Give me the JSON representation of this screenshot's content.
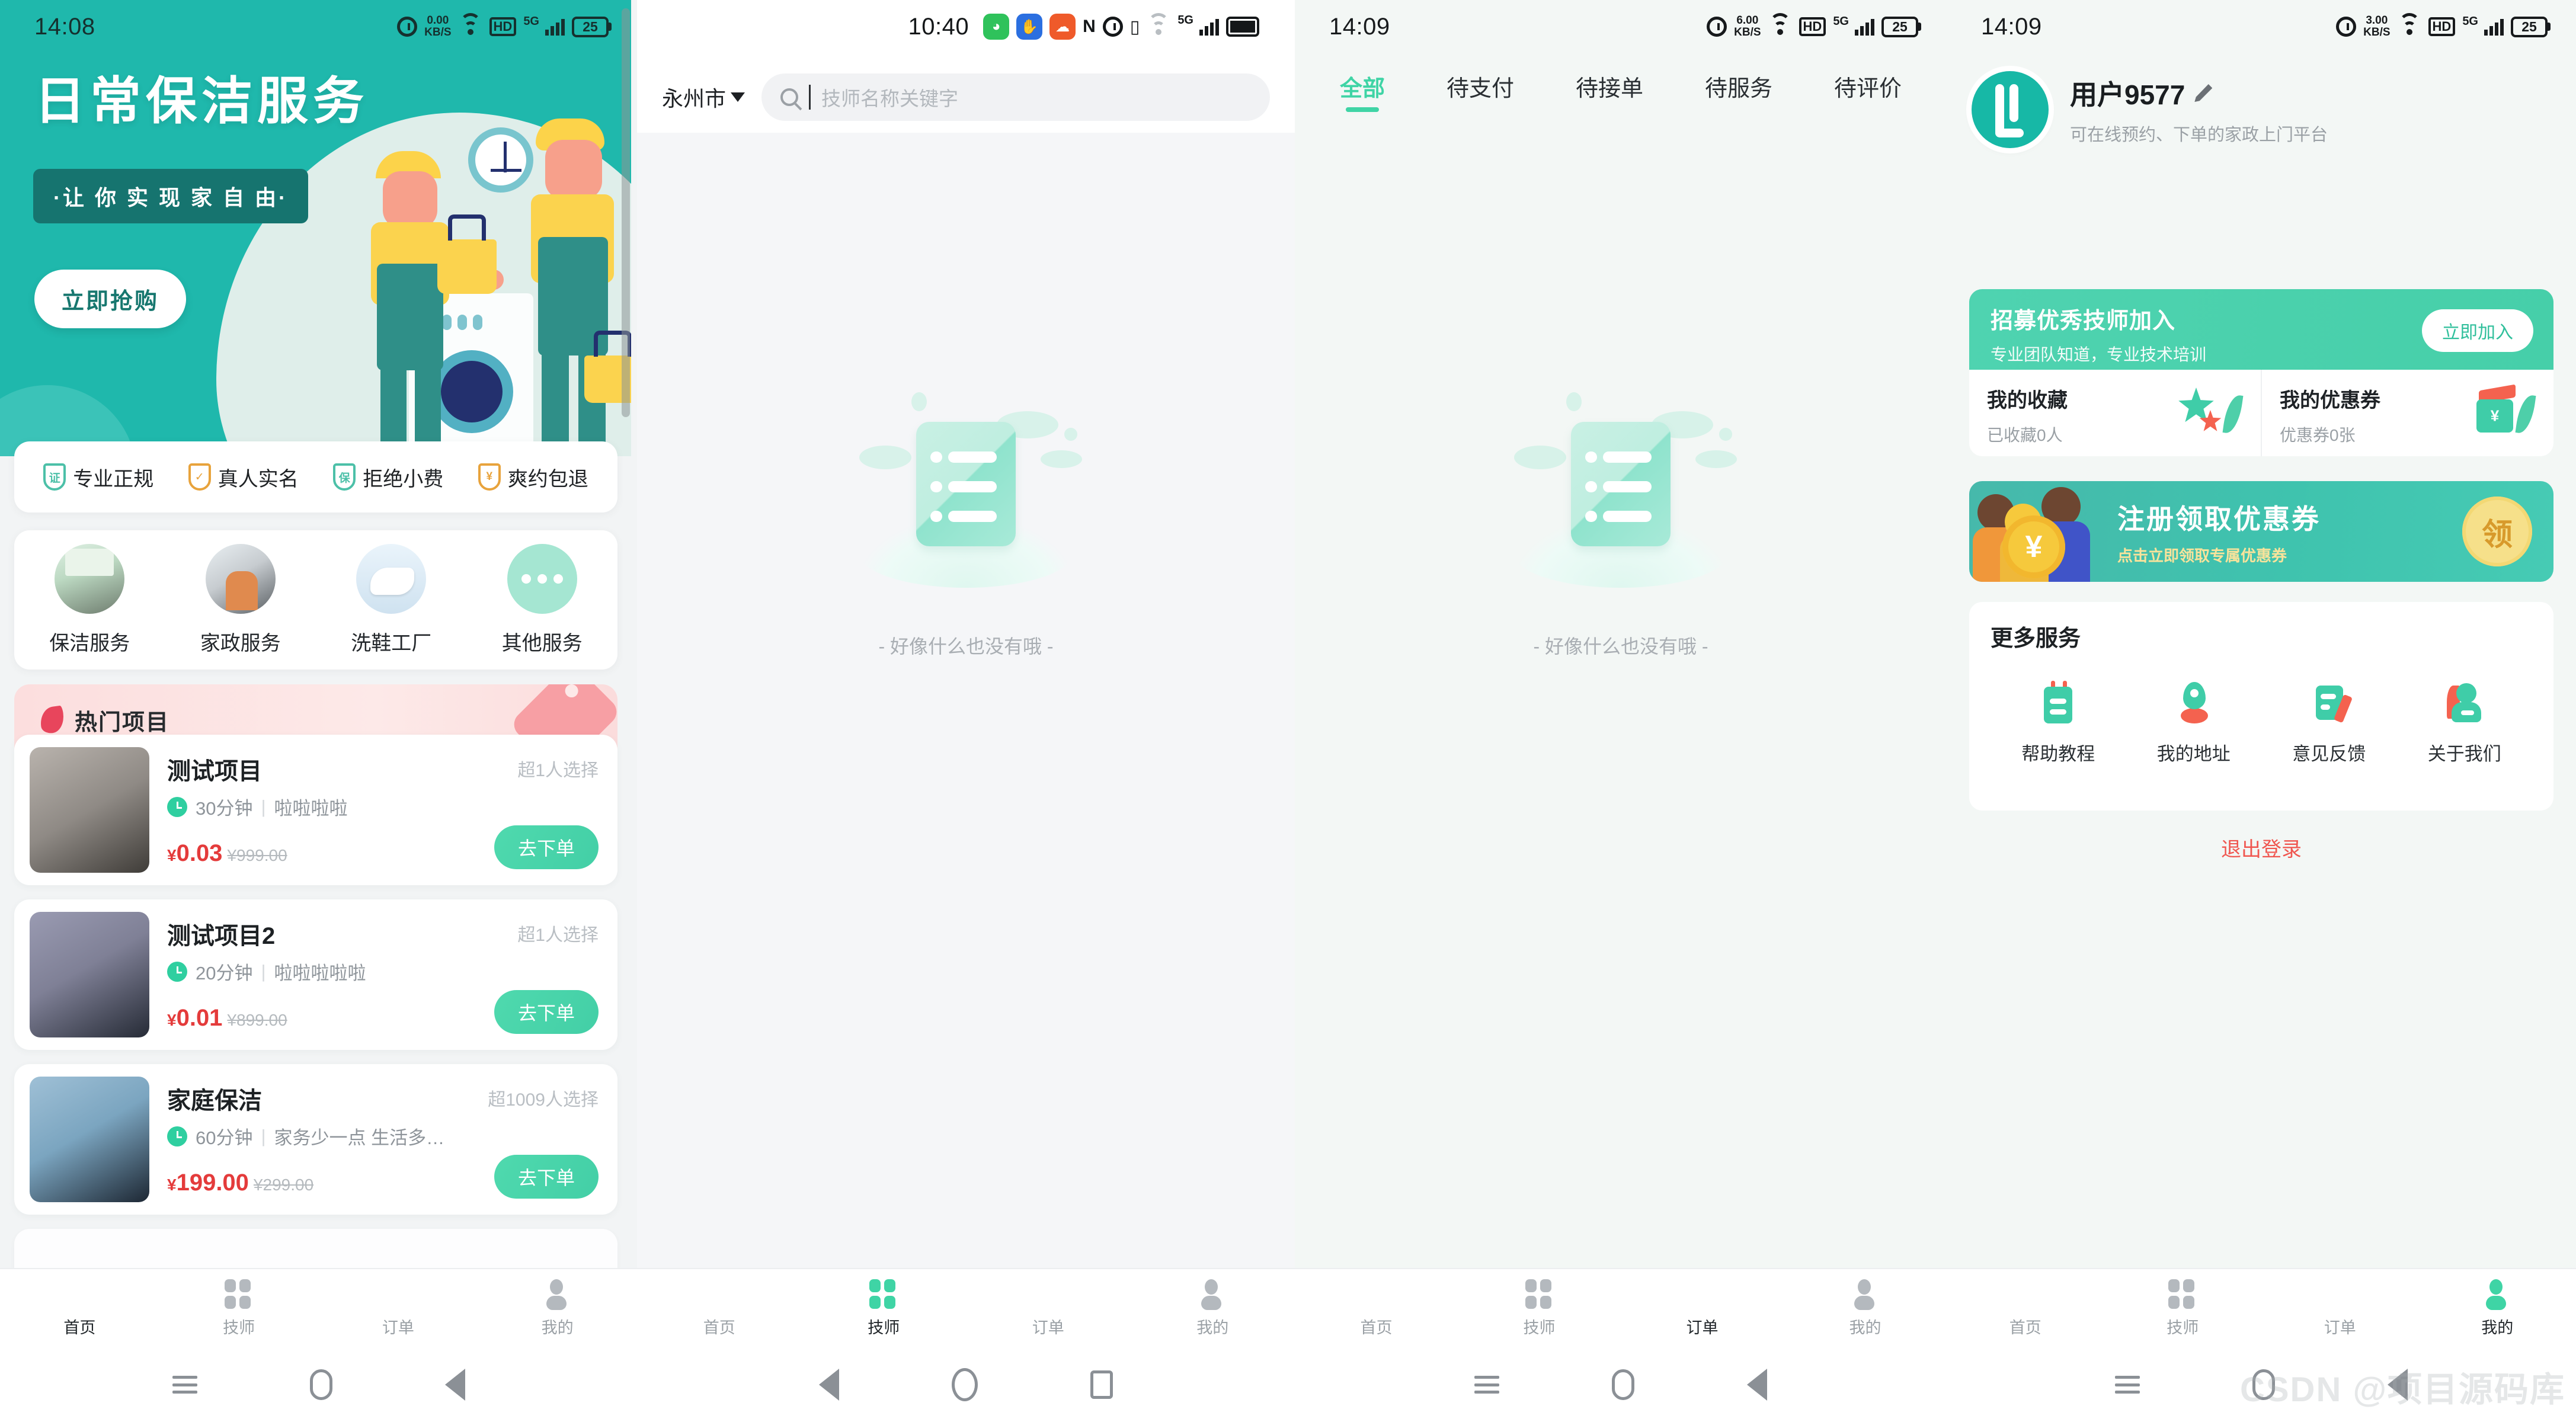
{
  "theme": {
    "brand_green": "#3fd4a5",
    "hero_teal": "#1fb8ac",
    "price_red": "#e43b3b",
    "logout_red": "#f0564f"
  },
  "panels": {
    "home": {
      "status": {
        "time": "14:08",
        "net_speed": "0.00",
        "net_unit": "KB/S",
        "hd": "HD",
        "net_type": "5G",
        "battery": "25"
      },
      "hero": {
        "title": "日常保洁服务",
        "subtitle": "·让 你 实 现 家 自 由·",
        "cta": "立即抢购"
      },
      "badges": [
        {
          "icon_text": "证",
          "label": "专业正规"
        },
        {
          "icon_text": "✓",
          "label": "真人实名"
        },
        {
          "icon_text": "保",
          "label": "拒绝小费"
        },
        {
          "icon_text": "¥",
          "label": "爽约包退"
        }
      ],
      "services": [
        {
          "label": "保洁服务"
        },
        {
          "label": "家政服务"
        },
        {
          "label": "洗鞋工厂"
        },
        {
          "label": "其他服务"
        }
      ],
      "hot_section_title": "热门项目",
      "products": [
        {
          "name": "测试项目",
          "people": "超1人选择",
          "duration": "30分钟",
          "desc": "啦啦啦啦",
          "price": "0.03",
          "old_price": "¥999.00",
          "button": "去下单"
        },
        {
          "name": "测试项目2",
          "people": "超1人选择",
          "duration": "20分钟",
          "desc": "啦啦啦啦啦",
          "price": "0.01",
          "old_price": "¥899.00",
          "button": "去下单"
        },
        {
          "name": "家庭保洁",
          "people": "超1009人选择",
          "duration": "60分钟",
          "desc": "家务少一点 生活多…",
          "price": "199.00",
          "old_price": "¥299.00",
          "button": "去下单"
        }
      ],
      "tabs": [
        {
          "label": "首页",
          "icon": "home-icon",
          "active": true
        },
        {
          "label": "技师",
          "icon": "grid-icon",
          "active": false
        },
        {
          "label": "订单",
          "icon": "bookmark-star-icon",
          "active": false
        },
        {
          "label": "我的",
          "icon": "person-icon",
          "active": false
        }
      ],
      "nav": [
        "menu-icon",
        "home-circle-icon",
        "back-triangle-icon"
      ]
    },
    "technicians": {
      "status": {
        "time": "10:40",
        "apps": [
          "wechat-icon",
          "alipay-icon",
          "app-icon"
        ],
        "icons": [
          "nfc-icon",
          "alarm-mute-icon",
          "vibrate-icon",
          "wifi-icon",
          "signal-5g-icon",
          "battery-icon"
        ]
      },
      "city": "永州市",
      "search_placeholder": "技师名称关键字",
      "search_value": "",
      "empty_text": "- 好像什么也没有哦 -",
      "tabs": [
        {
          "label": "首页",
          "icon": "home-icon",
          "active": false
        },
        {
          "label": "技师",
          "icon": "grid-icon",
          "active": true
        },
        {
          "label": "订单",
          "icon": "bookmark-star-icon",
          "active": false
        },
        {
          "label": "我的",
          "icon": "person-icon",
          "active": false
        }
      ],
      "nav": [
        "back-triangle-icon",
        "home-ellipse-icon",
        "recent-square-icon"
      ]
    },
    "orders": {
      "status": {
        "time": "14:09",
        "net_speed": "6.00",
        "net_unit": "KB/S",
        "hd": "HD",
        "net_type": "5G",
        "battery": "25"
      },
      "filter_tabs": [
        {
          "label": "全部",
          "active": true
        },
        {
          "label": "待支付",
          "active": false
        },
        {
          "label": "待接单",
          "active": false
        },
        {
          "label": "待服务",
          "active": false
        },
        {
          "label": "待评价",
          "active": false
        }
      ],
      "empty_text": "- 好像什么也没有哦 -",
      "tabs": [
        {
          "label": "首页",
          "icon": "home-icon",
          "active": false
        },
        {
          "label": "技师",
          "icon": "grid-icon",
          "active": false
        },
        {
          "label": "订单",
          "icon": "bookmark-star-icon",
          "active": true
        },
        {
          "label": "我的",
          "icon": "person-icon",
          "active": false
        }
      ],
      "nav": [
        "menu-icon",
        "home-circle-icon",
        "back-triangle-icon"
      ]
    },
    "profile": {
      "status": {
        "time": "14:09",
        "net_speed": "3.00",
        "net_unit": "KB/S",
        "hd": "HD",
        "net_type": "5G",
        "battery": "25"
      },
      "user_name": "用户9577",
      "user_desc": "可在线预约、下单的家政上门平台",
      "recruit": {
        "title": "招募优秀技师加入",
        "subtitle": "专业团队知道，专业技术培训",
        "button": "立即加入"
      },
      "stats": [
        {
          "title": "我的收藏",
          "sub": "已收藏0人"
        },
        {
          "title": "我的优惠券",
          "sub": "优惠券0张"
        }
      ],
      "coupon_banner": {
        "title": "注册领取优惠券",
        "subtitle": "点击立即领取专属优惠券",
        "badge": "领"
      },
      "more_title": "更多服务",
      "more_items": [
        {
          "label": "帮助教程",
          "icon": "help-book-icon"
        },
        {
          "label": "我的地址",
          "icon": "map-pin-icon"
        },
        {
          "label": "意见反馈",
          "icon": "feedback-pen-icon"
        },
        {
          "label": "关于我们",
          "icon": "about-people-icon"
        }
      ],
      "logout": "退出登录",
      "tabs": [
        {
          "label": "首页",
          "icon": "home-icon",
          "active": false
        },
        {
          "label": "技师",
          "icon": "grid-icon",
          "active": false
        },
        {
          "label": "订单",
          "icon": "bookmark-star-icon",
          "active": false
        },
        {
          "label": "我的",
          "icon": "person-icon",
          "active": true
        }
      ],
      "nav": [
        "menu-icon",
        "home-circle-icon",
        "back-triangle-icon"
      ]
    }
  },
  "watermark": "CSDN @项目源码库"
}
